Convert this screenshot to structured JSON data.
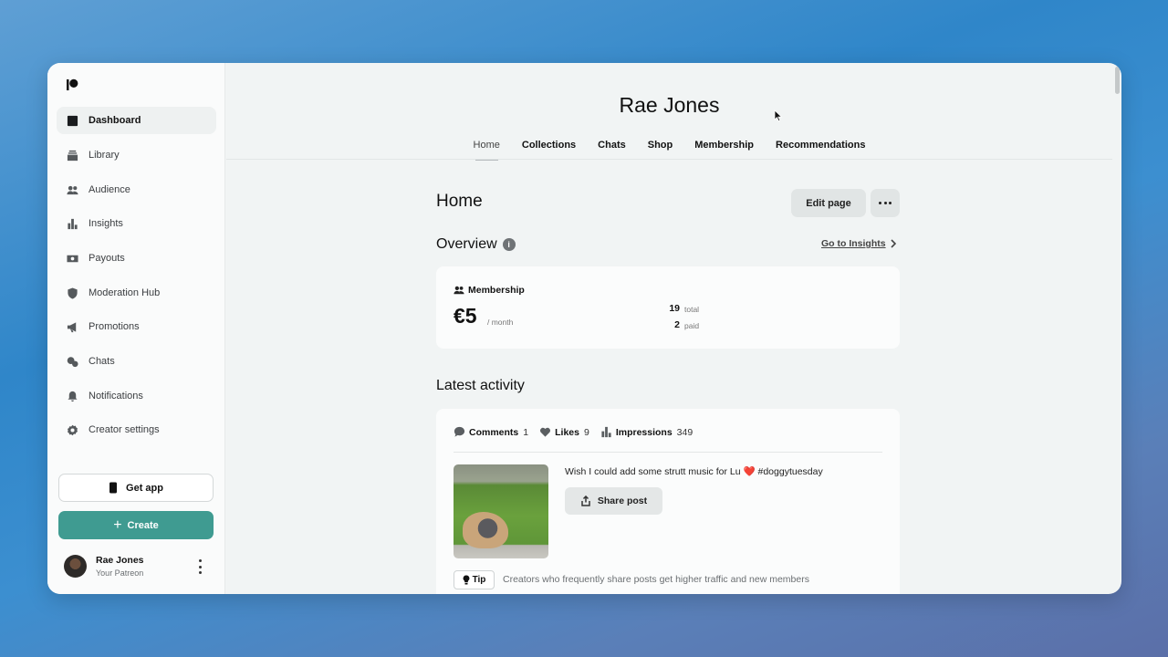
{
  "sidebar": {
    "items": [
      {
        "label": "Dashboard",
        "icon": "dashboard-icon",
        "active": true
      },
      {
        "label": "Library",
        "icon": "library-icon"
      },
      {
        "label": "Audience",
        "icon": "audience-icon"
      },
      {
        "label": "Insights",
        "icon": "insights-icon"
      },
      {
        "label": "Payouts",
        "icon": "payouts-icon"
      },
      {
        "label": "Moderation Hub",
        "icon": "shield-icon"
      },
      {
        "label": "Promotions",
        "icon": "megaphone-icon"
      },
      {
        "label": "Chats",
        "icon": "chat-icon"
      },
      {
        "label": "Notifications",
        "icon": "bell-icon"
      },
      {
        "label": "Creator settings",
        "icon": "gear-icon"
      }
    ],
    "get_app_label": "Get app",
    "create_label": "Create",
    "profile": {
      "name": "Rae Jones",
      "subtitle": "Your Patreon"
    }
  },
  "main": {
    "creator_name": "Rae Jones",
    "tabs": [
      {
        "label": "Home",
        "active": true
      },
      {
        "label": "Collections"
      },
      {
        "label": "Chats"
      },
      {
        "label": "Shop"
      },
      {
        "label": "Membership"
      },
      {
        "label": "Recommendations"
      }
    ],
    "page_title": "Home",
    "edit_page_label": "Edit page",
    "overview": {
      "heading": "Overview",
      "insights_link": "Go to Insights",
      "membership": {
        "label": "Membership",
        "price": "€5",
        "unit": "/ month",
        "total_value": "19",
        "total_label": "total",
        "paid_value": "2",
        "paid_label": "paid"
      }
    },
    "latest_activity": {
      "heading": "Latest activity",
      "comments_label": "Comments",
      "comments_value": "1",
      "likes_label": "Likes",
      "likes_value": "9",
      "impressions_label": "Impressions",
      "impressions_value": "349",
      "post_text": "Wish I could add some strutt music for Lu",
      "post_emoji": "❤️",
      "post_hashtag": "#doggytuesday",
      "share_label": "Share post",
      "tip_label": "Tip",
      "tip_text": "Creators who frequently share posts get higher traffic and new members"
    }
  },
  "colors": {
    "accent": "#3f9b91",
    "background_start": "#5f9fd4",
    "background_end": "#5b6fa8"
  }
}
